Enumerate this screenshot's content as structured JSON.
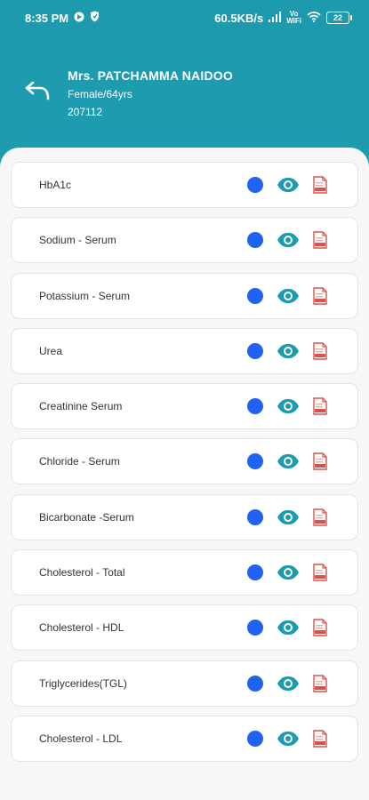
{
  "status_bar": {
    "time": "8:35 PM",
    "network_speed": "60.5KB/s",
    "volte_top": "Vo",
    "volte_bottom": "WiFi",
    "battery": "22",
    "icons": [
      "play-store-badge-icon",
      "shield-icon",
      "signal-icon",
      "wifi-icon",
      "battery-icon"
    ]
  },
  "header": {
    "back_icon": "back-arrow-icon",
    "patient_name": "Mrs. PATCHAMMA NAIDOO",
    "patient_meta": "Female/64yrs",
    "patient_id": "207112"
  },
  "colors": {
    "header_bg": "#1f9bb0",
    "status_dot": "#1f63f0",
    "eye": "#1a9bb0",
    "pdf": "#d9534f"
  },
  "tests": [
    {
      "name": "HbA1c"
    },
    {
      "name": "Sodium - Serum"
    },
    {
      "name": "Potassium - Serum"
    },
    {
      "name": "Urea"
    },
    {
      "name": "Creatinine Serum"
    },
    {
      "name": "Chloride - Serum"
    },
    {
      "name": "Bicarbonate -Serum"
    },
    {
      "name": "Cholesterol - Total"
    },
    {
      "name": "Cholesterol - HDL"
    },
    {
      "name": "Triglycerides(TGL)"
    },
    {
      "name": "Cholesterol - LDL"
    }
  ]
}
